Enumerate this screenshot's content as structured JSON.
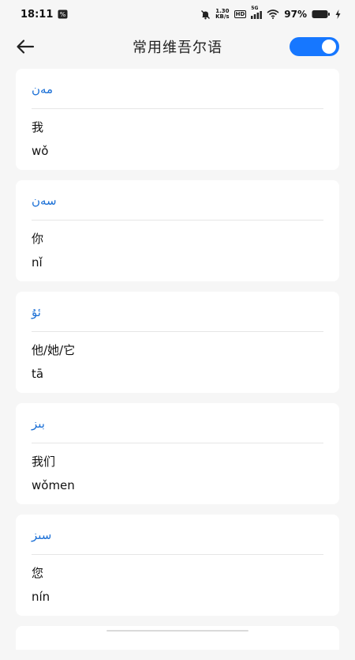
{
  "status_bar": {
    "time": "18:11",
    "network_speed_value": "1.30",
    "network_speed_unit": "KB/s",
    "hd_label": "HD",
    "signal_label": "5G",
    "battery_percent": "97%"
  },
  "header": {
    "title": "常用维吾尔语",
    "toggle_on": true
  },
  "phrases": [
    {
      "uyghur": "مەن",
      "chinese": "我",
      "pinyin": "wǒ"
    },
    {
      "uyghur": "سەن",
      "chinese": "你",
      "pinyin": "nǐ"
    },
    {
      "uyghur": "ئۇ",
      "chinese": "他/她/它",
      "pinyin": "tā"
    },
    {
      "uyghur": "بىز",
      "chinese": "我们",
      "pinyin": "wǒmen"
    },
    {
      "uyghur": "سىز",
      "chinese": "您",
      "pinyin": "nín"
    }
  ],
  "colors": {
    "accent": "#1677ff",
    "uyghur_text": "#1a6fd6",
    "background": "#f6f6f6",
    "card": "#ffffff"
  }
}
